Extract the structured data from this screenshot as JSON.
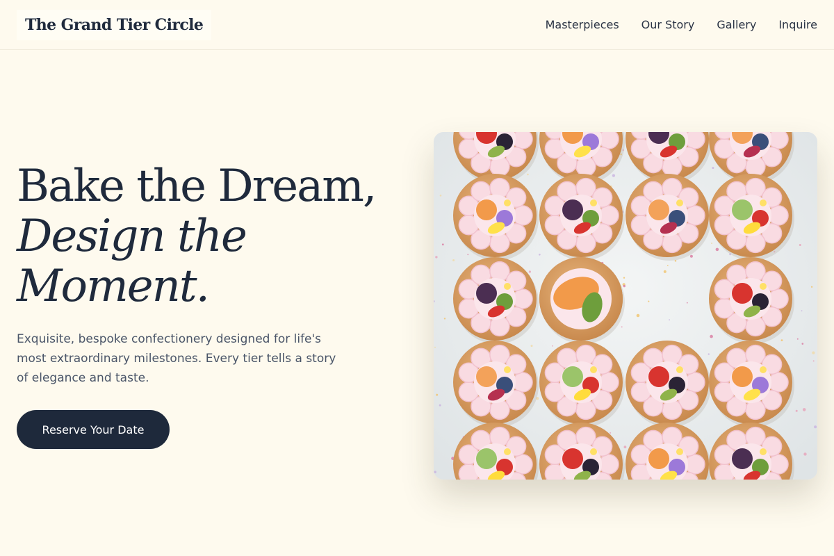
{
  "header": {
    "brand": "The Grand Tier Circle",
    "nav": [
      "Masterpieces",
      "Our Story",
      "Gallery",
      "Inquire"
    ]
  },
  "hero": {
    "title_line1": "Bake the Dream,",
    "title_line2": "Design the",
    "title_line3": "Moment.",
    "subtitle": "Exquisite, bespoke confectionery designed for life's most extraordinary milestones. Every tier tells a story of elegance and taste.",
    "cta": "Reserve Your Date"
  },
  "image": {
    "subject": "overhead photo of fruit-and-flower topped pastries on a pale surface"
  },
  "colors": {
    "background": "#fefaee",
    "text": "#1f2a3c",
    "button": "#1e293b",
    "button_text": "#ffffff"
  }
}
